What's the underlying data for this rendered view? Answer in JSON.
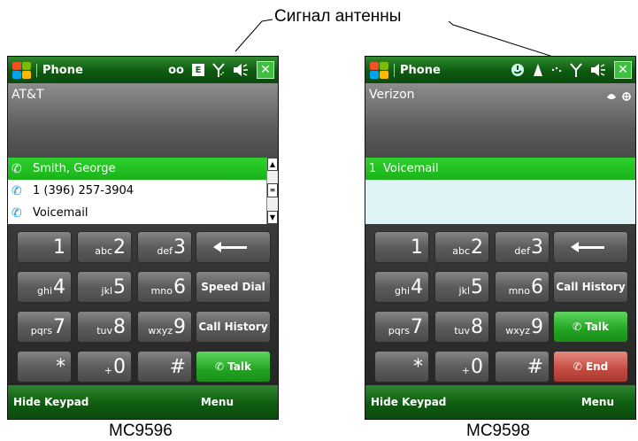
{
  "annotation": "Сигнал антенны",
  "phones": [
    {
      "model": "MC9596",
      "title": "Phone",
      "status": {
        "voicemail": "ᴏᴏ",
        "edge": "E",
        "close": "✕"
      },
      "carrier": "AT&T",
      "list": [
        "Smith, George",
        "1 (396) 257-3904",
        "Voicemail"
      ],
      "keys": {
        "k1": {
          "sub": "",
          "num": "1"
        },
        "k2": {
          "sub": "abc",
          "num": "2"
        },
        "k3": {
          "sub": "def",
          "num": "3"
        },
        "k4": {
          "sub": "ghi",
          "num": "4"
        },
        "k5": {
          "sub": "jkl",
          "num": "5"
        },
        "k6": {
          "sub": "mno",
          "num": "6"
        },
        "k7": {
          "sub": "pqrs",
          "num": "7"
        },
        "k8": {
          "sub": "tuv",
          "num": "8"
        },
        "k9": {
          "sub": "wxyz",
          "num": "9"
        },
        "kstar": {
          "sub": "",
          "num": "*"
        },
        "k0": {
          "sub": "+",
          "num": "0"
        },
        "khash": {
          "sub": "",
          "num": "#"
        }
      },
      "side_keys": [
        "Speed Dial",
        "Call History",
        "Talk"
      ],
      "softkeys": {
        "left": "Hide Keypad",
        "right": "Menu"
      }
    },
    {
      "model": "MC9598",
      "title": "Phone",
      "status": {
        "close": "✕"
      },
      "carrier": "Verizon",
      "list": [
        {
          "num": "1",
          "label": "Voicemail"
        }
      ],
      "keys": {
        "k1": {
          "sub": "",
          "num": "1"
        },
        "k2": {
          "sub": "abc",
          "num": "2"
        },
        "k3": {
          "sub": "def",
          "num": "3"
        },
        "k4": {
          "sub": "ghi",
          "num": "4"
        },
        "k5": {
          "sub": "jkl",
          "num": "5"
        },
        "k6": {
          "sub": "mno",
          "num": "6"
        },
        "k7": {
          "sub": "pqrs",
          "num": "7"
        },
        "k8": {
          "sub": "tuv",
          "num": "8"
        },
        "k9": {
          "sub": "wxyz",
          "num": "9"
        },
        "kstar": {
          "sub": "",
          "num": "*"
        },
        "k0": {
          "sub": "+",
          "num": "0"
        },
        "khash": {
          "sub": "",
          "num": "#"
        }
      },
      "side_keys": [
        "Call History",
        "Talk",
        "End"
      ],
      "softkeys": {
        "left": "Hide Keypad",
        "right": "Menu"
      }
    }
  ]
}
